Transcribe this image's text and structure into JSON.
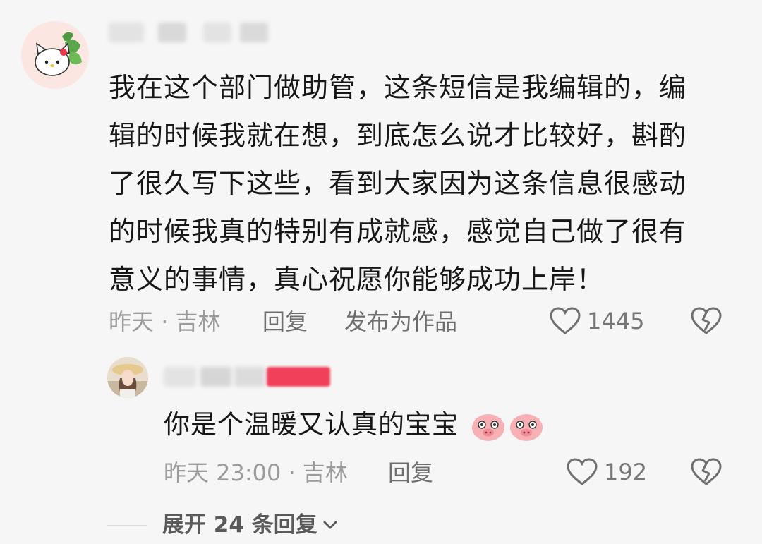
{
  "comment": {
    "text": "我在这个部门做助管，这条短信是我编辑的，编辑的时候我就在想，到底怎么说才比较好，斟酌了很久写下这些，看到大家因为这条信息很感动的时候我真的特别有成就感，感觉自己做了很有意义的事情，真心祝愿你能够成功上岸！",
    "lines": [
      "我在这个部门做助管，这条短信是我编辑的，编",
      "辑的时候我就在想，到底怎么说才比较好，斟酌",
      "了很久写下这些，看到大家因为这条信息很感动",
      "的时候我真的特别有成就感，感觉自己做了很有",
      "意义的事情，真心祝愿你能够成功上岸！"
    ],
    "time": "昨天",
    "location": "吉林",
    "reply_label": "回复",
    "publish_label": "发布为作品",
    "likes": "1445"
  },
  "reply": {
    "text": "你是个温暖又认真的宝宝",
    "time": "昨天 23:00",
    "location": "吉林",
    "reply_label": "回复",
    "likes": "192",
    "emojis": [
      "pig-emoji",
      "pig-emoji"
    ]
  },
  "expand_label": "展开 24 条回复",
  "colors": {
    "background": "#f6f6f6",
    "text": "#171717",
    "meta": "#9b9b9b",
    "reply_tag": "#f0405a"
  }
}
